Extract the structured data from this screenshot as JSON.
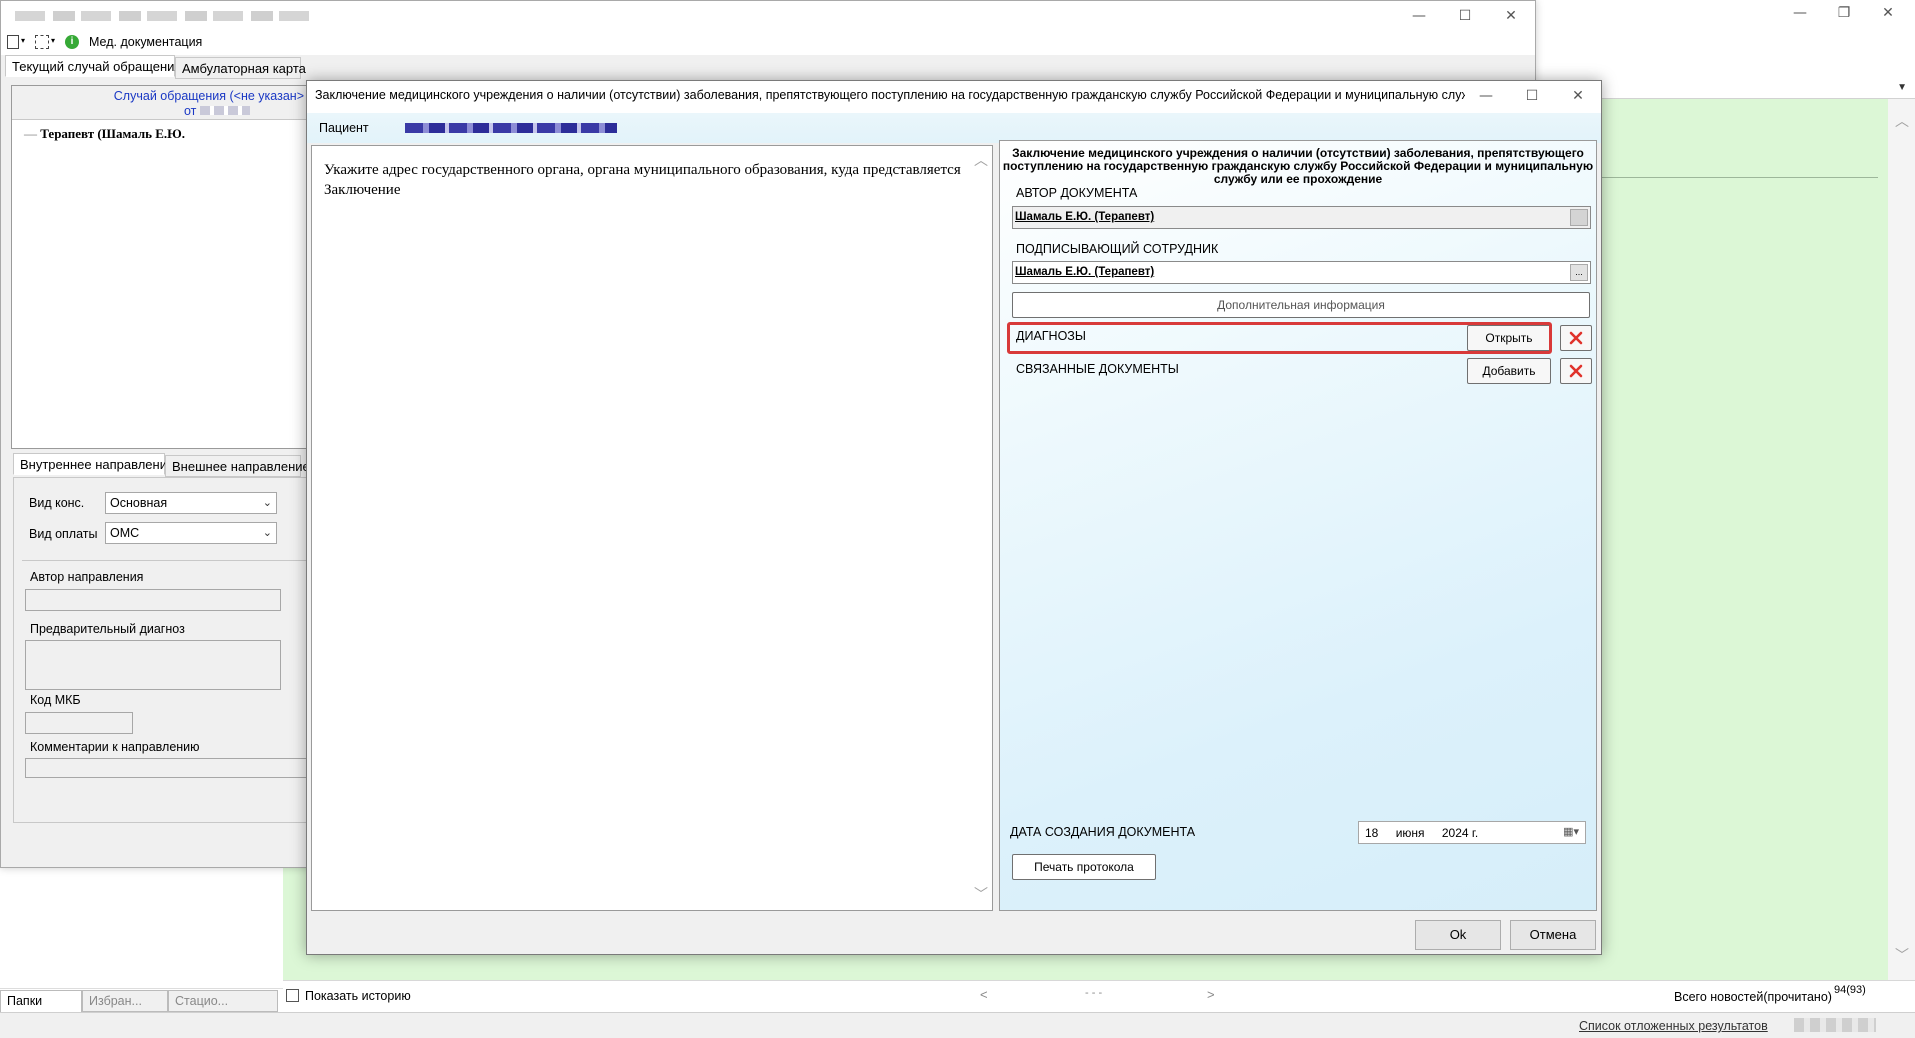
{
  "colors": {
    "accent_green": "#dcf7d6",
    "highlight": "#d83a3a",
    "link_blue": "#1a38c4"
  },
  "bg_window": {
    "controls": [
      "—",
      "❐",
      "✕"
    ],
    "bottom": {
      "show_history_label": "Показать историю",
      "nav_prev": "<",
      "nav_mid": "- - -",
      "nav_next": ">",
      "news_label": "Всего новостей(прочитано)",
      "news_count": "94(93)"
    },
    "left_tabs": [
      "Папки",
      "Избран...",
      "Стацио..."
    ],
    "status": {
      "deferred_link": "Список отложенных результатов"
    }
  },
  "win2": {
    "controls": [
      "—",
      "☐",
      "✕"
    ],
    "toolbar": {
      "info_icon": "info-icon",
      "med_docs_label": "Мед. документация"
    },
    "tabs": [
      "Текущий случай обращения",
      "Амбулаторная карта"
    ],
    "case_head_line1": "Случай обращения (<не указан>",
    "case_head_line2": "от",
    "tree_item": "Терапевт (Шамаль Е.Ю.",
    "subtabs": [
      "Внутреннее направление",
      "Внешнее направление"
    ],
    "form": {
      "consult_type_label": "Вид конс.",
      "consult_type_value": "Основная",
      "payment_type_label": "Вид оплаты",
      "payment_type_value": "ОМС",
      "author_label": "Автор направления",
      "prelim_diag_label": "Предварительный диагноз",
      "mkb_label": "Код МКБ",
      "comments_label": "Комментарии к направлению"
    }
  },
  "dialog": {
    "title": "Заключение медицинского учреждения о наличии (отсутствии) заболевания, препятствующего поступлению на государственную гражданскую службу Российской Федерации и муниципальную службу ...",
    "controls": [
      "—",
      "☐",
      "✕"
    ],
    "patient_label": "Пациент",
    "left_text": "Укажите адрес государственного органа, органа муниципального образования, куда представляется Заключение",
    "right_header": "Заключение медицинского учреждения о наличии (отсутствии) заболевания, препятствующего поступлению на государственную гражданскую службу Российской Федерации и муниципальную службу или ее прохождение",
    "author_label": "АВТОР ДОКУМЕНТА",
    "author_value": "Шамаль Е.Ю. (Терапевт)",
    "signer_label": "ПОДПИСЫВАЮЩИЙ СОТРУДНИК",
    "signer_value": "Шамаль Е.Ю. (Терапевт)",
    "signer_btn": "...",
    "extra_info_btn": "Дополнительная информация",
    "diagnoses_label": "ДИАГНОЗЫ",
    "diagnoses_open_btn": "Открыть",
    "linked_docs_label": "СВЯЗАННЫЕ ДОКУМЕНТЫ",
    "linked_docs_add_btn": "Добавить",
    "date_label": "ДАТА СОЗДАНИЯ ДОКУМЕНТА",
    "date_day": "18",
    "date_month": "июня",
    "date_year": "2024 г.",
    "print_btn": "Печать протокола",
    "ok_btn": "Ok",
    "cancel_btn": "Отмена"
  }
}
